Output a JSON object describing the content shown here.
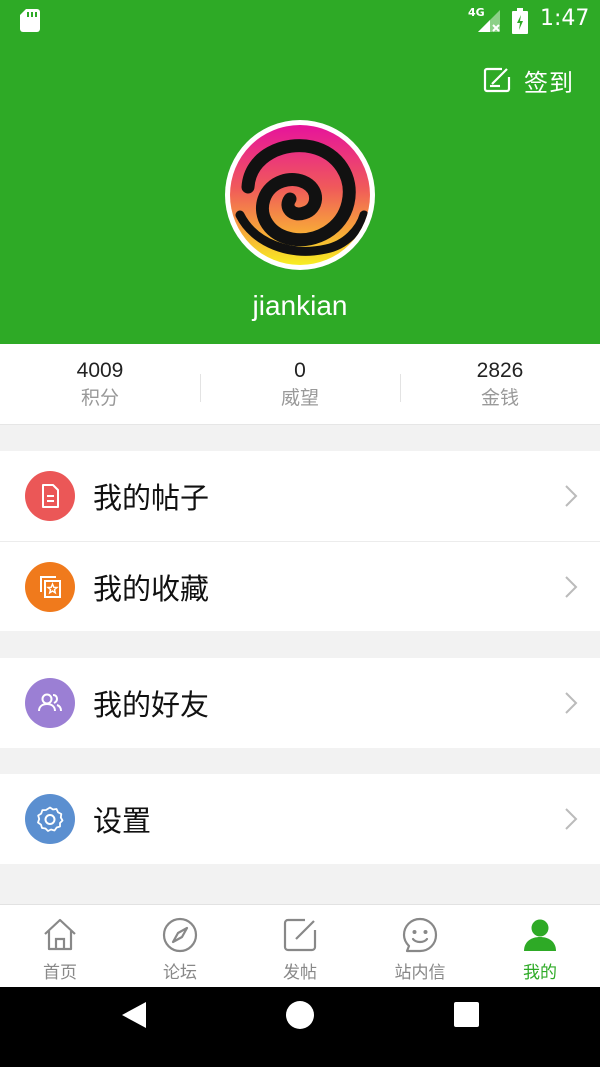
{
  "status_bar": {
    "network": "4G",
    "time": "1:47",
    "icons": [
      "sd-card-icon",
      "signal-icon",
      "battery-icon"
    ]
  },
  "header": {
    "checkin_label": "签到",
    "checkin_icon": "edit-square-icon",
    "username": "jiankian",
    "background_color": "#2eaa26"
  },
  "stats": [
    {
      "value": "4009",
      "label": "积分"
    },
    {
      "value": "0",
      "label": "威望"
    },
    {
      "value": "2826",
      "label": "金钱"
    }
  ],
  "menu": [
    {
      "label": "我的帖子",
      "icon": "document-icon",
      "color": "#eb5757"
    },
    {
      "label": "我的收藏",
      "icon": "star-collection-icon",
      "color": "#f07a1c"
    },
    {
      "label": "我的好友",
      "icon": "friends-icon",
      "color": "#9b7fd4"
    },
    {
      "label": "设置",
      "icon": "gear-icon",
      "color": "#5b8fd0"
    }
  ],
  "tabs": [
    {
      "label": "首页",
      "icon": "home-icon",
      "active": false
    },
    {
      "label": "论坛",
      "icon": "compass-icon",
      "active": false
    },
    {
      "label": "发帖",
      "icon": "compose-icon",
      "active": false
    },
    {
      "label": "站内信",
      "icon": "message-face-icon",
      "active": false
    },
    {
      "label": "我的",
      "icon": "person-icon",
      "active": true
    }
  ],
  "colors": {
    "accent": "#2eaa26",
    "tab_inactive": "#888888"
  }
}
